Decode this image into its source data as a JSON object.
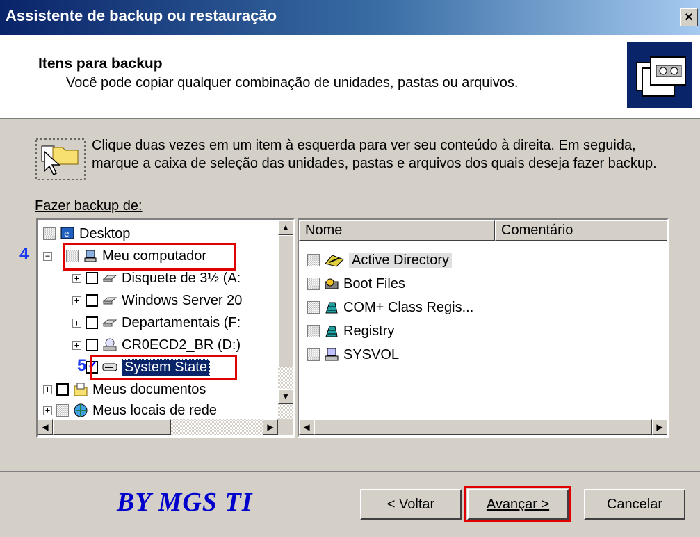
{
  "window": {
    "title": "Assistente de backup ou restauração",
    "close_label": "×"
  },
  "header": {
    "title": "Itens para backup",
    "subtitle": "Você pode copiar qualquer combinação de unidades, pastas ou arquivos."
  },
  "instructions": "Clique duas vezes em um item à esquerda para ver seu conteúdo à direita. Em seguida, marque a caixa de seleção das unidades, pastas e arquivos dos quais deseja fazer backup.",
  "backup_from_label": "Fazer backup de:",
  "tree": {
    "items": [
      {
        "label": "Desktop",
        "icon": "desktop-icon"
      },
      {
        "label": "Meu computador",
        "icon": "computer-icon"
      },
      {
        "label": "Disquete de 3½ (A:",
        "icon": "floppy-drive-icon"
      },
      {
        "label": "Windows Server 20",
        "icon": "hard-drive-icon"
      },
      {
        "label": "Departamentais (F:",
        "icon": "hard-drive-icon"
      },
      {
        "label": "CR0ECD2_BR (D:)",
        "icon": "cd-drive-icon"
      },
      {
        "label": "System State",
        "icon": "system-state-icon"
      },
      {
        "label": "Meus documentos",
        "icon": "documents-icon"
      },
      {
        "label": "Meus locais de rede",
        "icon": "network-icon"
      }
    ]
  },
  "list": {
    "columns": [
      "Nome",
      "Comentário"
    ],
    "items": [
      {
        "label": "Active Directory",
        "icon": "active-directory-icon"
      },
      {
        "label": "Boot Files",
        "icon": "boot-files-icon"
      },
      {
        "label": "COM+ Class Regis...",
        "icon": "com-registry-icon"
      },
      {
        "label": "Registry",
        "icon": "registry-icon"
      },
      {
        "label": "SYSVOL",
        "icon": "sysvol-icon"
      }
    ]
  },
  "annotations": {
    "step4": "4",
    "step5": "5"
  },
  "brand": "BY MGS TI",
  "buttons": {
    "back": "< Voltar",
    "next": "Avançar >",
    "cancel": "Cancelar"
  },
  "colors": {
    "titlebar_start": "#0a246a",
    "highlight_box": "#e00000",
    "step_number": "#1e3cf0",
    "brand": "#0000cc"
  }
}
